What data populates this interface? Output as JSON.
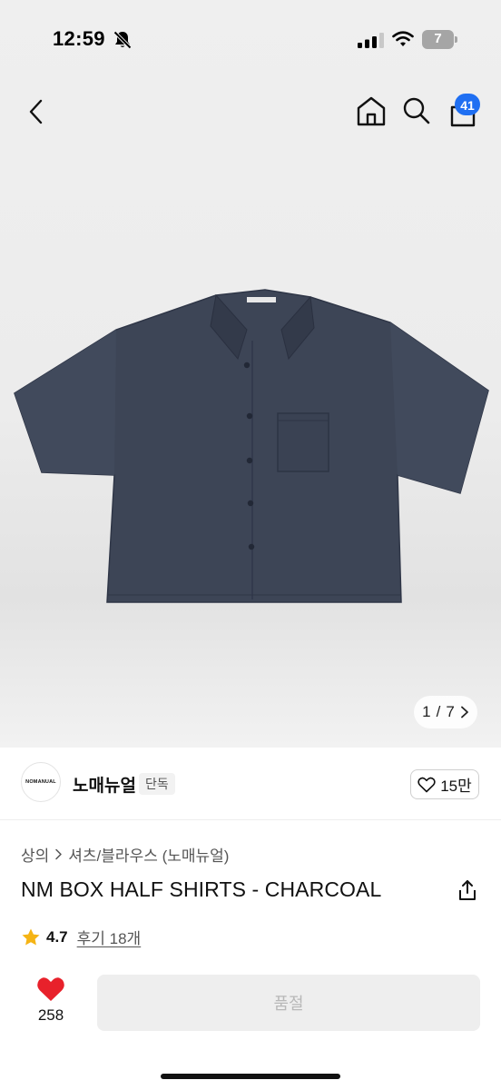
{
  "status_bar": {
    "time": "12:59",
    "battery": "7",
    "icons": [
      "bell-slash-icon",
      "signal-icon",
      "wifi-icon",
      "battery-icon"
    ]
  },
  "nav": {
    "icons": [
      "chevron-left-icon",
      "home-icon",
      "search-icon",
      "shopping-bag-icon"
    ],
    "cart_badge": "41",
    "badge_color": "#1f6ff2"
  },
  "gallery": {
    "current": "1",
    "separator": "/",
    "total": "7"
  },
  "brand": {
    "logo_text": "NOMANUAL",
    "name": "노매뉴얼",
    "badge": "단독",
    "like_count": "15만"
  },
  "product": {
    "breadcrumb": [
      "상의",
      "셔츠/블라우스 (노매뉴얼)"
    ],
    "title": "NM BOX HALF SHIRTS - CHARCOAL",
    "rating": "4.7",
    "reviews": "후기 18개",
    "star_color": "#f5b415"
  },
  "actions": {
    "like_count": "258",
    "heart_color": "#e8212b",
    "soldout_label": "품절"
  }
}
